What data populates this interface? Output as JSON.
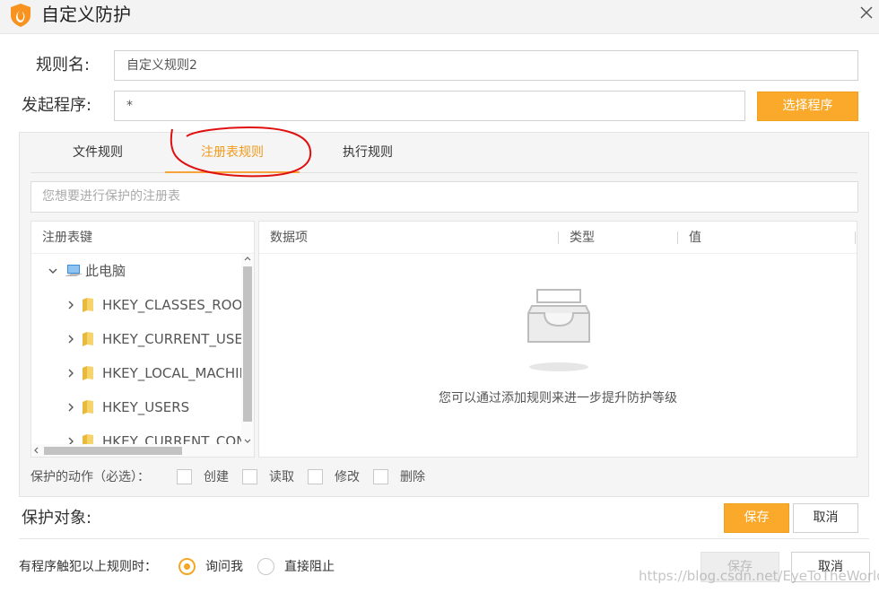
{
  "window": {
    "title": "自定义防护"
  },
  "rule_name": {
    "label": "规则名:",
    "value": "自定义规则2"
  },
  "launcher": {
    "label": "发起程序:",
    "value": "*",
    "button": "选择程序"
  },
  "tabs": [
    {
      "label": "文件规则",
      "active": false
    },
    {
      "label": "注册表规则",
      "active": true
    },
    {
      "label": "执行规则",
      "active": false
    }
  ],
  "registry_search": {
    "placeholder": "您想要进行保护的注册表"
  },
  "tree": {
    "header": "注册表键",
    "root": "此电脑",
    "items": [
      "HKEY_CLASSES_ROOT",
      "HKEY_CURRENT_USER",
      "HKEY_LOCAL_MACHINE",
      "HKEY_USERS",
      "HKEY_CURRENT_CON"
    ]
  },
  "data_table": {
    "columns": [
      "数据项",
      "类型",
      "值"
    ],
    "empty_text": "您可以通过添加规则来进一步提升防护等级"
  },
  "actions": {
    "label": "保护的动作（必选）：",
    "options": [
      "创建",
      "读取",
      "修改",
      "删除"
    ]
  },
  "protect_target": {
    "label": "保护对象:",
    "save": "保存",
    "cancel": "取消"
  },
  "trigger": {
    "label": "有程序触犯以上规则时：",
    "options": [
      {
        "label": "询问我",
        "checked": true
      },
      {
        "label": "直接阻止",
        "checked": false
      }
    ],
    "save": "保存",
    "cancel": "取消"
  },
  "watermark": "https://blog.csdn.net/EyeToTheWorld",
  "colors": {
    "accent": "#fba92b",
    "active_tab": "#f39a1b",
    "annotation": "#e01010"
  }
}
